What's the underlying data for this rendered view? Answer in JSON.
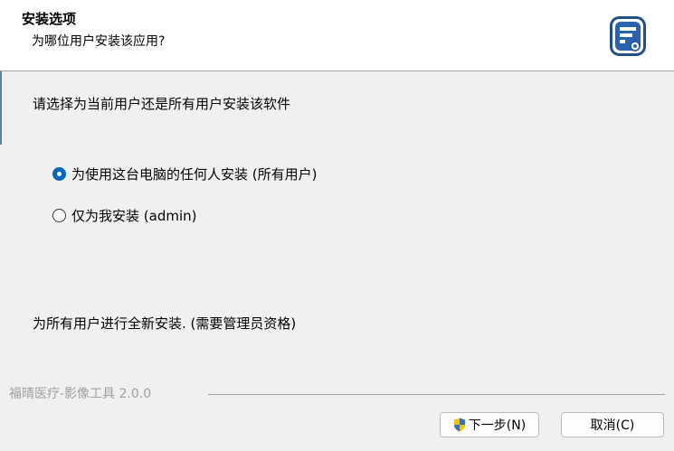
{
  "header": {
    "title": "安装选项",
    "subtitle": "为哪位用户安装该应用?",
    "icon": "installer-app-icon"
  },
  "main": {
    "prompt": "请选择为当前用户还是所有用户安装该软件",
    "options": [
      {
        "label": "为使用这台电脑的任何人安装 (所有用户)",
        "checked": true
      },
      {
        "label": "仅为我安装 (admin)",
        "checked": false
      }
    ],
    "status": "为所有用户进行全新安装. (需要管理员资格)"
  },
  "footer": {
    "brand": "福晴医疗-影像工具 2.0.0",
    "next_label": "下一步(N)",
    "next_icon": "uac-shield-icon",
    "cancel_label": "取消(C)"
  },
  "colors": {
    "accent": "#0067c0",
    "header_bg": "#ffffff",
    "body_bg": "#f0f0f0",
    "brand_text": "#a0a0a0"
  }
}
